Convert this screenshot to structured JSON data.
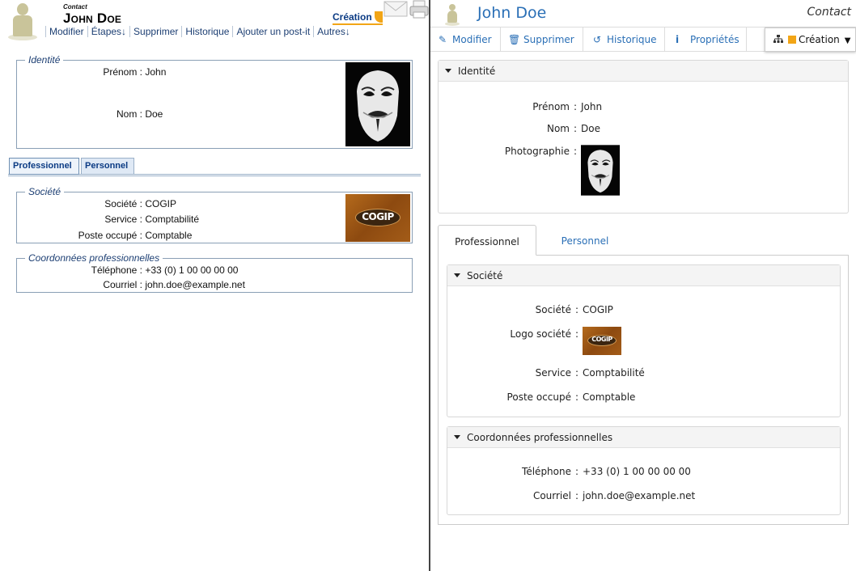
{
  "left": {
    "small_label": "Contact",
    "name": "John Doe",
    "menu": [
      "Modifier",
      "Étapes↓",
      "Supprimer",
      "Historique",
      "Ajouter un post-it",
      "Autres↓"
    ],
    "state": "Création",
    "identity": {
      "legend": "Identité",
      "fields": [
        {
          "label": "Prénom :",
          "value": "John"
        },
        {
          "label": "Nom :",
          "value": "Doe"
        }
      ]
    },
    "tabs": [
      "Professionnel",
      "Personnel"
    ],
    "company": {
      "legend": "Société",
      "fields": [
        {
          "label": "Société :",
          "value": "COGIP"
        },
        {
          "label": "Service :",
          "value": "Comptabilité"
        },
        {
          "label": "Poste occupé :",
          "value": "Comptable"
        }
      ]
    },
    "contact": {
      "legend": "Coordonnées professionnelles",
      "fields": [
        {
          "label": "Téléphone :",
          "value": "+33 (0) 1 00 00 00 00"
        },
        {
          "label": "Courriel :",
          "value": "john.doe@example.net"
        }
      ]
    },
    "logo_text": "COGIP"
  },
  "right": {
    "name": "John Doe",
    "type": "Contact",
    "toolbar": {
      "edit": "Modifier",
      "delete": "Supprimer",
      "history": "Historique",
      "properties": "Propriétés"
    },
    "state": "Création",
    "identity": {
      "title": "Identité",
      "first_name_label": "Prénom",
      "first_name": "John",
      "last_name_label": "Nom",
      "last_name": "Doe",
      "photo_label": "Photographie"
    },
    "tabs": [
      "Professionnel",
      "Personnel"
    ],
    "company": {
      "title": "Société",
      "company_label": "Société",
      "company": "COGIP",
      "logo_label": "Logo société",
      "service_label": "Service",
      "service": "Comptabilité",
      "position_label": "Poste occupé",
      "position": "Comptable"
    },
    "contact": {
      "title": "Coordonnées professionnelles",
      "phone_label": "Téléphone",
      "phone": "+33 (0) 1 00 00 00 00",
      "email_label": "Courriel",
      "email": "john.doe@example.net"
    },
    "separator": ":",
    "logo_text": "COGIP"
  },
  "colors": {
    "accent_blue": "#2a6fb6",
    "state_orange": "#f2a516",
    "legacy_blue": "#1d3f73"
  }
}
